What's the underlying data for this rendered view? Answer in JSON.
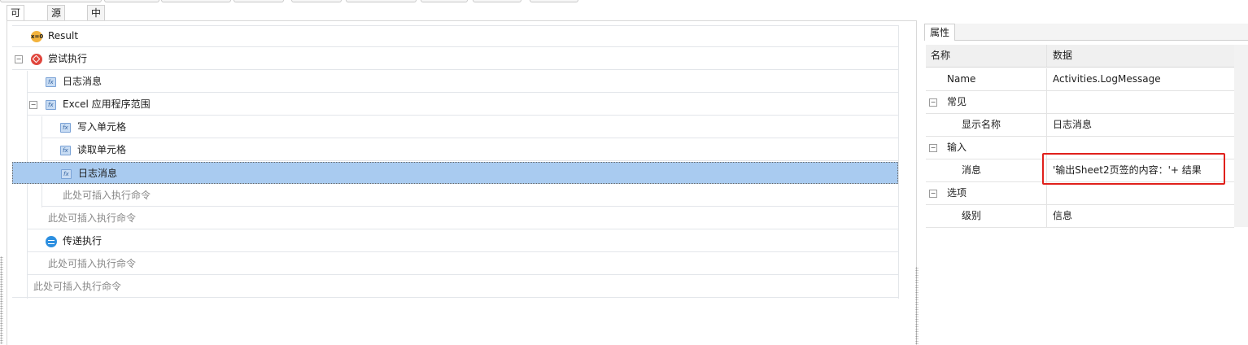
{
  "tabs": [
    "可视化",
    "源代码",
    "中文格式"
  ],
  "workflow": {
    "result_label": "Result",
    "try_label": "尝试执行",
    "log1": "日志消息",
    "excel_scope": "Excel 应用程序范围",
    "write_cell": "写入单元格",
    "read_cell": "读取单元格",
    "log2": "日志消息",
    "insert_hint": "此处可插入执行命令",
    "pass_label": "传递执行"
  },
  "properties": {
    "tab_label": "属性",
    "col_name": "名称",
    "col_data": "数据",
    "name_key": "Name",
    "name_value": "Activities.LogMessage",
    "cat_common": "常见",
    "display_name_key": "显示名称",
    "display_name_value": "日志消息",
    "cat_input": "输入",
    "message_key": "消息",
    "message_value": "'输出Sheet2页签的内容：'+ 结果",
    "cat_options": "选项",
    "level_key": "级别",
    "level_value": "信息"
  },
  "colors": {
    "selection": "#a9cbf0",
    "highlight_box": "#e0201b"
  }
}
